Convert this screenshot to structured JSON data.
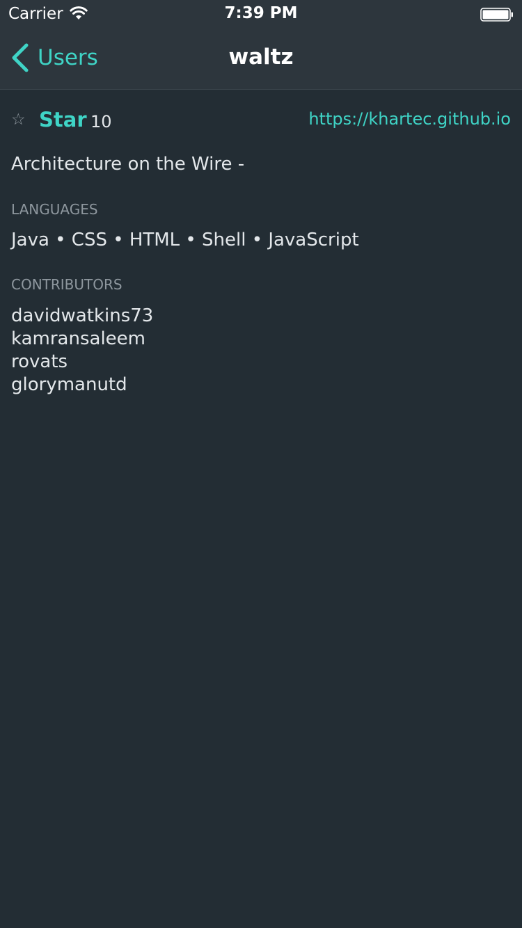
{
  "status_bar": {
    "carrier": "Carrier",
    "time": "7:39 PM",
    "wifi_icon": "wifi-icon",
    "battery_icon": "battery-icon"
  },
  "nav": {
    "back_label": "Users",
    "back_icon": "chevron-left-icon",
    "title": "waltz"
  },
  "repo": {
    "star_icon": "star-outline-icon",
    "star_label": "Star",
    "star_count": "10",
    "homepage": "https://khartec.github.io",
    "description": "Architecture on the Wire -"
  },
  "languages": {
    "header": "LANGUAGES",
    "text": "Java • CSS • HTML • Shell • JavaScript"
  },
  "contributors": {
    "header": "CONTRIBUTORS",
    "items": [
      "davidwatkins73",
      "kamransaleem",
      "rovats",
      "glorymanutd"
    ]
  },
  "colors": {
    "background": "#232d34",
    "bar_background": "#2d363d",
    "accent": "#3fd4c6",
    "text": "#e3e7ea",
    "muted": "#8e979e"
  }
}
